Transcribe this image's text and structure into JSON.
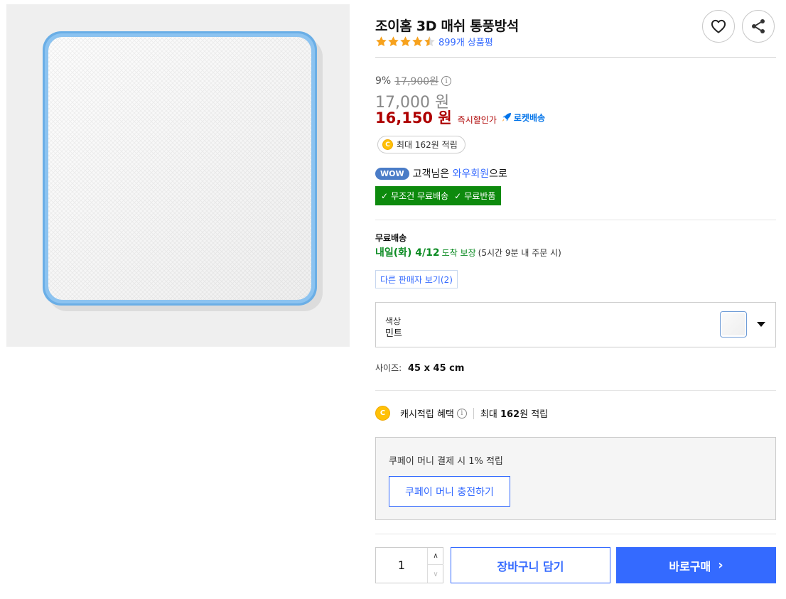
{
  "product": {
    "title": "조이홈 3D 매쉬 통풍방석",
    "rating_stars": 4.5,
    "review_count": "899개 상품평",
    "image_alt": "mesh cushion"
  },
  "actions": {
    "wishlist_icon": "heart-icon",
    "share_icon": "share-icon"
  },
  "pricing": {
    "discount_rate": "9%",
    "original_price": "17,900원",
    "info_symbol": "i",
    "sale_price": "17,000 원",
    "instant_price": "16,150 원",
    "instant_label": "즉시할인가",
    "rocket_label": "로켓배송"
  },
  "reward": {
    "coin_letter": "C",
    "text": "최대 162원 적립"
  },
  "wow": {
    "badge": "WOW",
    "prefix": "고객님은 ",
    "link": "와우회원",
    "suffix": "으로",
    "check_mark": "✓",
    "benefit_1": "무조건 무료배송",
    "benefit_2": "무료반품"
  },
  "shipping": {
    "title": "무료배송",
    "date": "내일(화) 4/12",
    "guarantee": "도착 보장",
    "note": "(5시간 9분 내 주문 시)",
    "other_sellers": "다른 판매자 보기(2)"
  },
  "option": {
    "label": "색상",
    "value": "민트"
  },
  "size": {
    "label": "사이즈:",
    "value": "45 x 45 cm"
  },
  "cash": {
    "coin_letter": "C",
    "label": "캐시적립 혜택",
    "max_prefix": "최대 ",
    "max_amount": "162",
    "max_suffix": "원 적립"
  },
  "coupay": {
    "text": "쿠페이 머니 결제 시 1% 적립",
    "button": "쿠페이 머니 충전하기"
  },
  "purchase": {
    "quantity": "1",
    "qty_up": "∧",
    "qty_down": "∨",
    "cart_button": "장바구니 담기",
    "buy_button": "바로구매",
    "buy_chevron": "›"
  },
  "colors": {
    "accent": "#346aff",
    "price_red": "#ae0000",
    "delivery_green": "#0b8b22",
    "wow_green": "#0d8a0d",
    "star": "#f7a21d"
  }
}
